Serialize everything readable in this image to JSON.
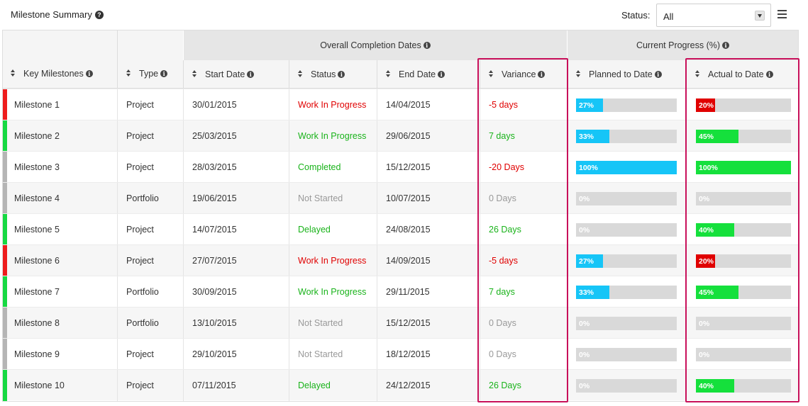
{
  "header": {
    "title": "Milestone Summary",
    "status_label": "Status:",
    "status_value": "All"
  },
  "table": {
    "group_overall": "Overall Completion Dates",
    "group_progress": "Current Progress (%)",
    "columns": {
      "milestone": "Key Milestones",
      "type": "Type",
      "start": "Start Date",
      "status": "Status",
      "end": "End Date",
      "variance": "Variance",
      "planned": "Planned to Date",
      "actual": "Actual to Date"
    },
    "rows": [
      {
        "name": "Milestone 1",
        "type": "Project",
        "start": "30/01/2015",
        "status": "Work In Progress",
        "end": "14/04/2015",
        "variance": "-5 days",
        "planned": 27,
        "planned_label": "27%",
        "actual": 20,
        "actual_label": "20%",
        "indicator": "#ee1c1c",
        "status_color": "#e00000",
        "variance_color": "#e00000",
        "actual_color": "#e00000"
      },
      {
        "name": "Milestone 2",
        "type": "Project",
        "start": "25/03/2015",
        "status": "Work In Progress",
        "end": "29/06/2015",
        "variance": "7 days",
        "planned": 33,
        "planned_label": "33%",
        "actual": 45,
        "actual_label": "45%",
        "indicator": "#16d942",
        "status_color": "#19b31a",
        "variance_color": "#19b31a",
        "actual_color": "#15e03c"
      },
      {
        "name": "Milestone 3",
        "type": "Project",
        "start": "28/03/2015",
        "status": "Completed",
        "end": "15/12/2015",
        "variance": "-20 Days",
        "planned": 100,
        "planned_label": "100%",
        "actual": 100,
        "actual_label": "100%",
        "indicator": "#b5b5b5",
        "status_color": "#19b31a",
        "variance_color": "#e00000",
        "actual_color": "#15e03c"
      },
      {
        "name": "Milestone 4",
        "type": "Portfolio",
        "start": "19/06/2015",
        "status": "Not Started",
        "end": "10/07/2015",
        "variance": "0 Days",
        "planned": 0,
        "planned_label": "0%",
        "actual": 0,
        "actual_label": "0%",
        "indicator": "#b5b5b5",
        "status_color": "#999999",
        "variance_color": "#999999",
        "actual_color": "#15e03c"
      },
      {
        "name": "Milestone 5",
        "type": "Project",
        "start": "14/07/2015",
        "status": "Delayed",
        "end": "24/08/2015",
        "variance": "26 Days",
        "planned": 0,
        "planned_label": "0%",
        "actual": 40,
        "actual_label": "40%",
        "indicator": "#16d942",
        "status_color": "#19b31a",
        "variance_color": "#19b31a",
        "actual_color": "#15e03c"
      },
      {
        "name": "Milestone 6",
        "type": "Project",
        "start": "27/07/2015",
        "status": "Work In Progress",
        "end": "14/09/2015",
        "variance": "-5 days",
        "planned": 27,
        "planned_label": "27%",
        "actual": 20,
        "actual_label": "20%",
        "indicator": "#ee1c1c",
        "status_color": "#e00000",
        "variance_color": "#e00000",
        "actual_color": "#e00000"
      },
      {
        "name": "Milestone 7",
        "type": "Portfolio",
        "start": "30/09/2015",
        "status": "Work In Progress",
        "end": "29/11/2015",
        "variance": "7 days",
        "planned": 33,
        "planned_label": "33%",
        "actual": 45,
        "actual_label": "45%",
        "indicator": "#16d942",
        "status_color": "#19b31a",
        "variance_color": "#19b31a",
        "actual_color": "#15e03c"
      },
      {
        "name": "Milestone 8",
        "type": "Portfolio",
        "start": "13/10/2015",
        "status": "Not Started",
        "end": "15/12/2015",
        "variance": "0 Days",
        "planned": 0,
        "planned_label": "0%",
        "actual": 0,
        "actual_label": "0%",
        "indicator": "#b5b5b5",
        "status_color": "#999999",
        "variance_color": "#999999",
        "actual_color": "#15e03c"
      },
      {
        "name": "Milestone 9",
        "type": "Project",
        "start": "29/10/2015",
        "status": "Not Started",
        "end": "18/12/2015",
        "variance": "0 Days",
        "planned": 0,
        "planned_label": "0%",
        "actual": 0,
        "actual_label": "0%",
        "indicator": "#b5b5b5",
        "status_color": "#999999",
        "variance_color": "#999999",
        "actual_color": "#15e03c"
      },
      {
        "name": "Milestone 10",
        "type": "Project",
        "start": "07/11/2015",
        "status": "Delayed",
        "end": "24/12/2015",
        "variance": "26 Days",
        "planned": 0,
        "planned_label": "0%",
        "actual": 40,
        "actual_label": "40%",
        "indicator": "#16d942",
        "status_color": "#19b31a",
        "variance_color": "#19b31a",
        "actual_color": "#15e03c"
      }
    ]
  },
  "colors": {
    "planned_fill": "#16c5f7",
    "highlight": "#c8105a"
  }
}
